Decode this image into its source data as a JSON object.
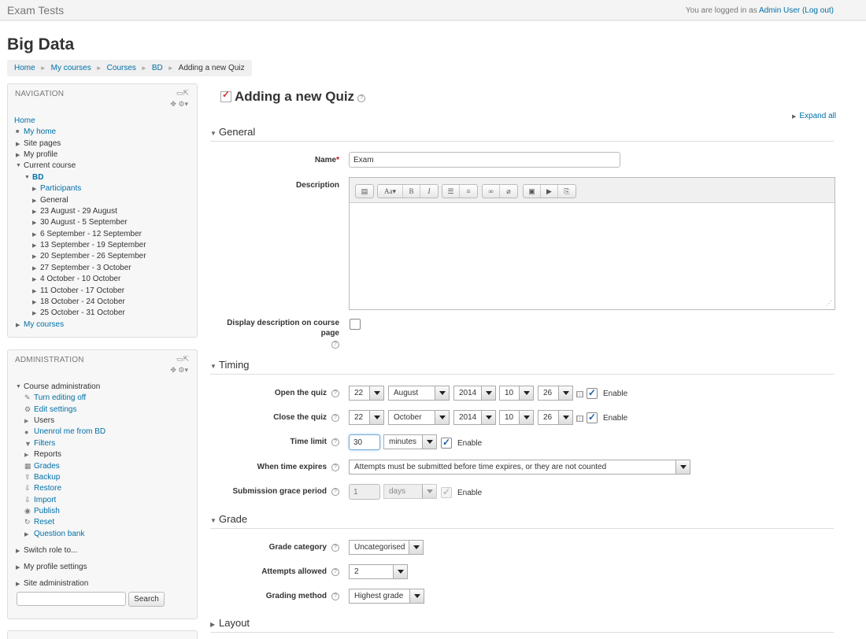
{
  "header": {
    "site_name": "Exam Tests",
    "logged_in_prefix": "You are logged in as ",
    "user_name": "Admin User",
    "logout_text": "(Log out)"
  },
  "page_title": "Big Data",
  "breadcrumb": [
    "Home",
    "My courses",
    "Courses",
    "BD",
    "Adding a new Quiz"
  ],
  "navigation": {
    "title": "NAVIGATION",
    "home": "Home",
    "my_home": "My home",
    "site_pages": "Site pages",
    "my_profile": "My profile",
    "current_course": "Current course",
    "course": "BD",
    "participants": "Participants",
    "general": "General",
    "weeks": [
      "23 August - 29 August",
      "30 August - 5 September",
      "6 September - 12 September",
      "13 September - 19 September",
      "20 September - 26 September",
      "27 September - 3 October",
      "4 October - 10 October",
      "11 October - 17 October",
      "18 October - 24 October",
      "25 October - 31 October"
    ],
    "my_courses": "My courses"
  },
  "administration": {
    "title": "ADMINISTRATION",
    "course_admin": "Course administration",
    "turn_editing_off": "Turn editing off",
    "edit_settings": "Edit settings",
    "users": "Users",
    "unenrol": "Unenrol me from BD",
    "filters": "Filters",
    "reports": "Reports",
    "grades": "Grades",
    "backup": "Backup",
    "restore": "Restore",
    "import": "Import",
    "publish": "Publish",
    "reset": "Reset",
    "question_bank": "Question bank",
    "switch_role": "Switch role to...",
    "my_profile_settings": "My profile settings",
    "site_administration": "Site administration",
    "search_button": "Search"
  },
  "main": {
    "heading": "Adding a new Quiz",
    "expand_all": "Expand all",
    "sections": {
      "general": "General",
      "timing": "Timing",
      "grade": "Grade",
      "layout": "Layout"
    },
    "general": {
      "name_label": "Name",
      "name_required": "*",
      "name_value": "Exam",
      "description_label": "Description",
      "display_desc_label_1": "Display description on course",
      "display_desc_label_2": "page"
    },
    "timing": {
      "open_label": "Open the quiz",
      "open": {
        "day": "22",
        "month": "August",
        "year": "2014",
        "hour": "10",
        "minute": "26"
      },
      "close_label": "Close the quiz",
      "close": {
        "day": "22",
        "month": "October",
        "year": "2014",
        "hour": "10",
        "minute": "26"
      },
      "time_limit_label": "Time limit",
      "time_limit_value": "30",
      "time_limit_unit": "minutes",
      "when_expires_label": "When time expires",
      "when_expires_value": "Attempts must be submitted before time expires, or they are not counted",
      "grace_label": "Submission grace period",
      "grace_value": "1",
      "grace_unit": "days",
      "enable": "Enable"
    },
    "grade": {
      "category_label": "Grade category",
      "category_value": "Uncategorised",
      "attempts_label": "Attempts allowed",
      "attempts_value": "2",
      "method_label": "Grading method",
      "method_value": "Highest grade"
    }
  }
}
